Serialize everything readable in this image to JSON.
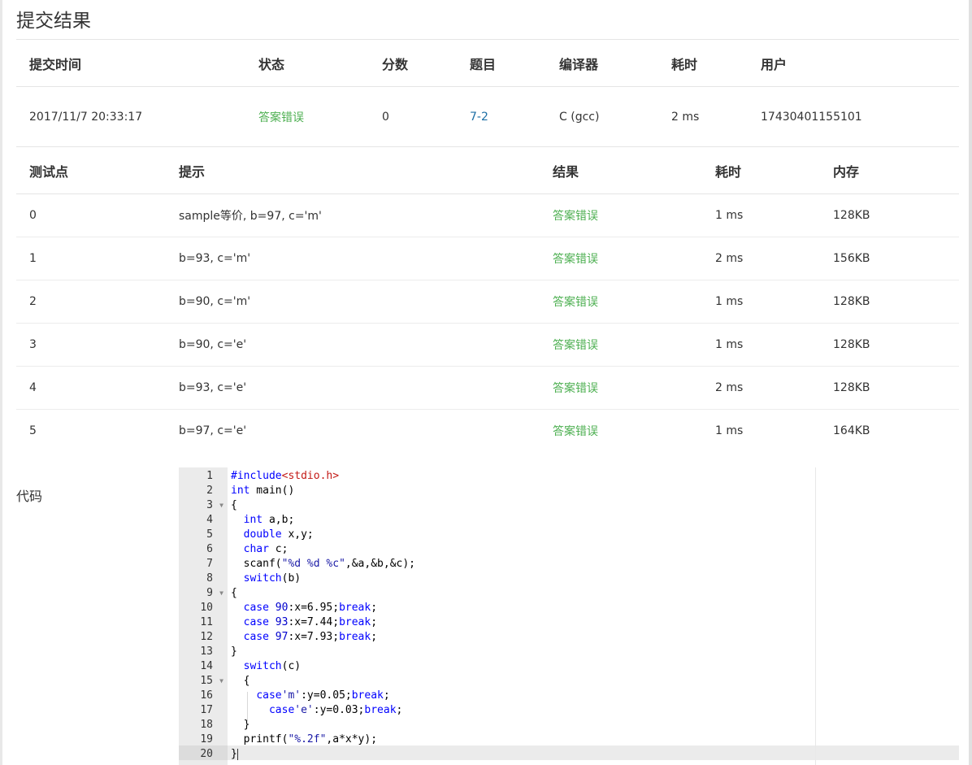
{
  "page": {
    "title": "提交结果"
  },
  "submission": {
    "headers": [
      "提交时间",
      "状态",
      "分数",
      "题目",
      "编译器",
      "耗时",
      "用户"
    ],
    "row": {
      "time": "2017/11/7 20:33:17",
      "status": "答案错误",
      "score": "0",
      "problem": "7-2",
      "compiler": "C (gcc)",
      "elapsed": "2 ms",
      "user": "17430401155101"
    }
  },
  "tests": {
    "headers": [
      "测试点",
      "提示",
      "结果",
      "耗时",
      "内存"
    ],
    "rows": [
      {
        "id": "0",
        "hint": "sample等价, b=97, c='m'",
        "result": "答案错误",
        "time": "1 ms",
        "memory": "128KB"
      },
      {
        "id": "1",
        "hint": "b=93, c='m'",
        "result": "答案错误",
        "time": "2 ms",
        "memory": "156KB"
      },
      {
        "id": "2",
        "hint": "b=90, c='m'",
        "result": "答案错误",
        "time": "1 ms",
        "memory": "128KB"
      },
      {
        "id": "3",
        "hint": "b=90, c='e'",
        "result": "答案错误",
        "time": "1 ms",
        "memory": "128KB"
      },
      {
        "id": "4",
        "hint": "b=93, c='e'",
        "result": "答案错误",
        "time": "2 ms",
        "memory": "128KB"
      },
      {
        "id": "5",
        "hint": "b=97, c='e'",
        "result": "答案错误",
        "time": "1 ms",
        "memory": "164KB"
      }
    ]
  },
  "code": {
    "label": "代码",
    "lines": [
      "#include<stdio.h>",
      "int main()",
      "{",
      "  int a,b;",
      "  double x,y;",
      "  char c;",
      "  scanf(\"%d %d %c\",&a,&b,&c);",
      "  switch(b)",
      "{",
      "  case 90:x=6.95;break;",
      "  case 93:x=7.44;break;",
      "  case 97:x=7.93;break;",
      "}",
      "  switch(c)",
      "  {",
      "    case'm':y=0.05;break;",
      "      case'e':y=0.03;break;",
      "  }",
      "  printf(\"%.2f\",a*x*y);",
      "}"
    ],
    "fold_lines": [
      3,
      9,
      15
    ],
    "active_line": 20
  },
  "colors": {
    "status_error": "#4caf50",
    "problem_link": "#1d6fa5"
  }
}
